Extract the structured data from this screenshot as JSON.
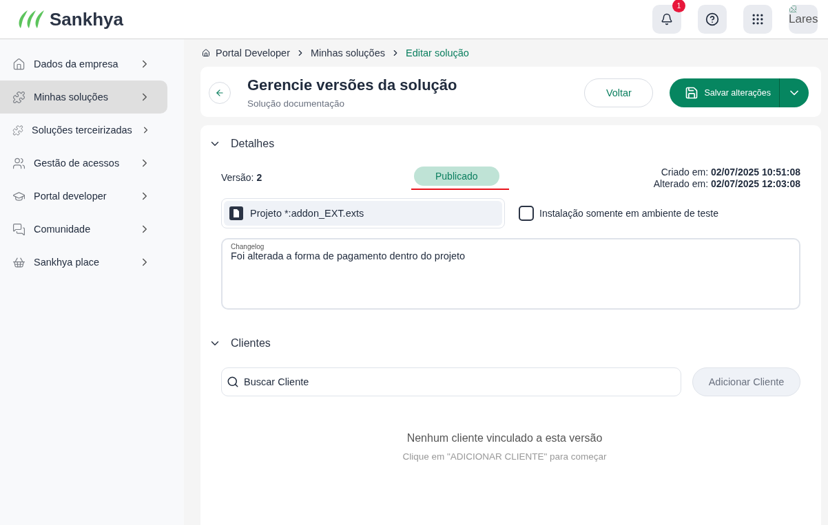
{
  "header": {
    "brand": "Sankhya",
    "notifications": {
      "count": "1"
    },
    "avatar": {
      "alt_text": "Lares"
    }
  },
  "sidebar": {
    "items": [
      {
        "label": "Dados da empresa",
        "selected": false
      },
      {
        "label": "Minhas soluções",
        "selected": true
      },
      {
        "label": "Soluções terceirizadas",
        "selected": false
      },
      {
        "label": "Gestão de acessos",
        "selected": false
      },
      {
        "label": "Portal developer",
        "selected": false
      },
      {
        "label": "Comunidade",
        "selected": false
      },
      {
        "label": "Sankhya place",
        "selected": false
      }
    ]
  },
  "breadcrumb": [
    {
      "label": "Portal Developer",
      "selected": false
    },
    {
      "label": "Minhas soluções",
      "selected": false
    },
    {
      "label": "Editar solução",
      "selected": true
    }
  ],
  "page": {
    "title": "Gerencie versões da solução",
    "subtitle": "Solução documentação",
    "buttons": {
      "back": "Voltar",
      "save": "Salvar alterações"
    }
  },
  "details": {
    "heading": "Detalhes",
    "expanded": true,
    "version_label": "Versão:",
    "version": "2",
    "status": "Publicado",
    "status_underlined": true,
    "created_label": "Criado em:",
    "created": "02/07/2025 10:51:08",
    "changed_label": "Alterado em:",
    "changed": "02/07/2025 12:03:08",
    "file": "Projeto *:addon_EXT.exts",
    "test_only": {
      "label": "Instalação somente em ambiente de teste",
      "checked": false
    },
    "changelog": {
      "label": "Changelog",
      "value": "Foi alterada a forma de pagamento dentro do projeto"
    }
  },
  "clients": {
    "heading": "Clientes",
    "expanded": true,
    "search": {
      "placeholder": "Buscar Cliente"
    },
    "add_button": {
      "label": "Adicionar Cliente",
      "disabled": true
    },
    "empty_title": "Nenhum cliente vinculado a esta versão",
    "empty_hint": "Clique em \"ADICIONAR CLIENTE\" para começar"
  }
}
